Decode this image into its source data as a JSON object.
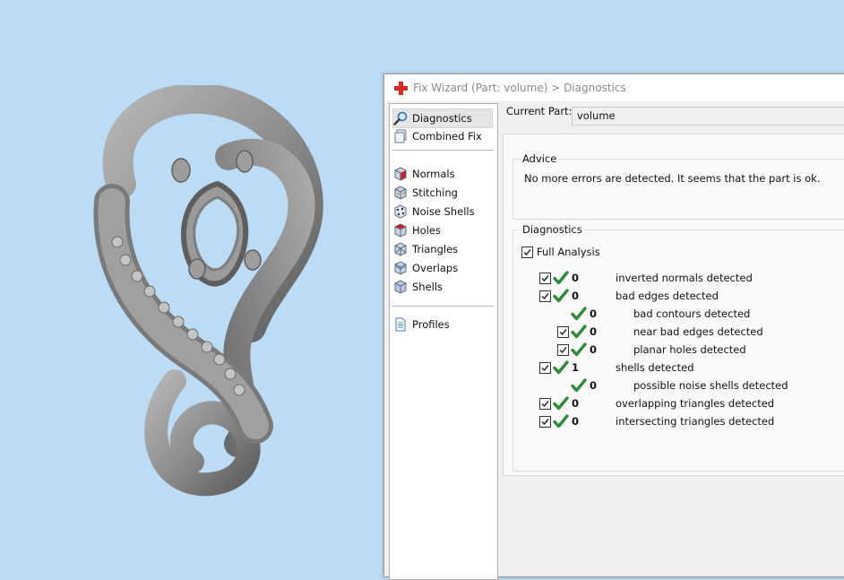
{
  "dialog": {
    "title": "Fix Wizard (Part: volume) > Diagnostics",
    "current_part_label": "Current Part:",
    "current_part_value": "volume"
  },
  "nav": {
    "items": [
      {
        "label": "Diagnostics",
        "icon": "magnifier-icon",
        "selected": true
      },
      {
        "label": "Combined Fix",
        "icon": "combined-fix-icon"
      },
      {
        "label": "Normals",
        "icon": "normals-cube-icon"
      },
      {
        "label": "Stitching",
        "icon": "stitching-cube-icon"
      },
      {
        "label": "Noise Shells",
        "icon": "noise-shells-cube-icon"
      },
      {
        "label": "Holes",
        "icon": "holes-cube-icon"
      },
      {
        "label": "Triangles",
        "icon": "triangles-cube-icon"
      },
      {
        "label": "Overlaps",
        "icon": "overlaps-cube-icon"
      },
      {
        "label": "Shells",
        "icon": "shells-cube-icon"
      },
      {
        "label": "Profiles",
        "icon": "profiles-document-icon"
      }
    ]
  },
  "advice": {
    "title": "Advice",
    "text": "No more errors are detected. It seems that the part is ok."
  },
  "diagnostics": {
    "title": "Diagnostics",
    "full_analysis_label": "Full Analysis",
    "full_analysis_checked": true,
    "rows": [
      {
        "count": "0",
        "label": "inverted normals detected",
        "checkbox": true,
        "indent": 0
      },
      {
        "count": "0",
        "label": "bad edges detected",
        "checkbox": true,
        "indent": 0
      },
      {
        "count": "0",
        "label": "bad contours detected",
        "checkbox": false,
        "indent": 1
      },
      {
        "count": "0",
        "label": "near bad edges detected",
        "checkbox": true,
        "indent": 1
      },
      {
        "count": "0",
        "label": "planar holes detected",
        "checkbox": true,
        "indent": 1
      },
      {
        "count": "1",
        "label": "shells detected",
        "checkbox": true,
        "indent": 0
      },
      {
        "count": "0",
        "label": "possible noise shells detected",
        "checkbox": false,
        "indent": 1
      },
      {
        "count": "0",
        "label": "overlapping triangles detected",
        "checkbox": true,
        "indent": 0
      },
      {
        "count": "0",
        "label": "intersecting triangles detected",
        "checkbox": true,
        "indent": 0
      }
    ]
  },
  "colors": {
    "viewport_bg": "#bcdcf6",
    "check_green": "#2e8b3a",
    "model_gray": "#8c8c8c"
  }
}
